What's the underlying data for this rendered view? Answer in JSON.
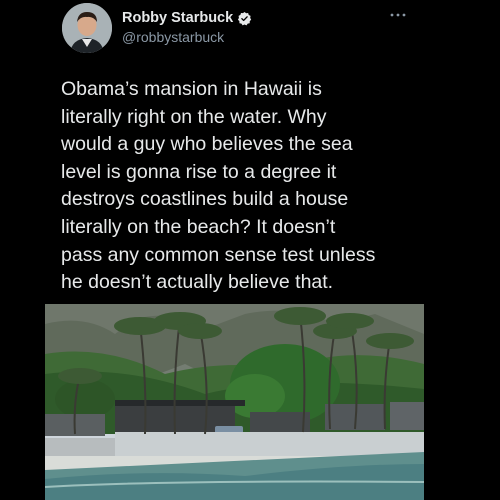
{
  "tweet": {
    "author_name": "Robby Starbuck",
    "author_handle": "@robbystarbuck",
    "text": "Obama’s mansion in Hawaii is\nliterally right on the water. Why\nwould a guy who believes the sea\nlevel is gonna rise to a degree it\ndestroys coastlines build a house\nliterally on the beach? It doesn’t\npass any common sense test unless\nhe doesn’t actually believe that."
  },
  "icons": [
    "verified-badge-icon",
    "more-options-icon"
  ],
  "colors": {
    "background": "#000000",
    "text": "#e7e9ea",
    "secondary_text": "#8b98a5",
    "verified": "#1d9bf0"
  }
}
